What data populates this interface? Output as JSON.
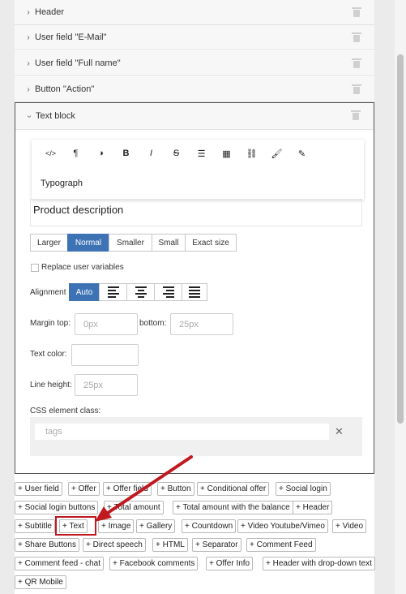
{
  "accordion": {
    "collapsed_items": [
      {
        "label": "Header"
      },
      {
        "label": "User field \"E-Mail\""
      },
      {
        "label": "User field \"Full name\""
      },
      {
        "label": "Button \"Action\""
      }
    ],
    "open_item": {
      "label": "Text block"
    }
  },
  "toolbar": {
    "icons": [
      "code-icon",
      "paragraph-icon",
      "contrast-icon",
      "bold-icon",
      "italic-icon",
      "strikethrough-icon",
      "list-icon",
      "table-icon",
      "link-icon",
      "brush-icon",
      "pencil-icon"
    ],
    "code_glyph": "</>",
    "paragraph_glyph": "¶",
    "contrast_glyph": "◑",
    "bold_glyph": "B",
    "italic_glyph": "I",
    "strike_glyph": "S",
    "list_glyph": "☰",
    "table_glyph": "▦",
    "link_glyph": "⛓",
    "brush_glyph": "🖌",
    "pencil_glyph": "✎",
    "typograph_label": "Typograph"
  },
  "editor": {
    "content": "Product description"
  },
  "size": {
    "options": [
      "Larger",
      "Normal",
      "Smaller",
      "Small",
      "Exact size"
    ],
    "selected": "Normal"
  },
  "replace_vars": {
    "label": "Replace user variables",
    "checked": false
  },
  "alignment": {
    "label": "Alignment",
    "auto_label": "Auto",
    "selected": "Auto"
  },
  "margin": {
    "top_label": "Margin top:",
    "top_placeholder": "0px",
    "bottom_label": "bottom:",
    "bottom_placeholder": "25px"
  },
  "text_color": {
    "label": "Text color:"
  },
  "line_height": {
    "label": "Line height:",
    "placeholder": "25px"
  },
  "css_class": {
    "label": "CSS element class:",
    "placeholder": "tags",
    "clear": "✕"
  },
  "add_buttons": [
    [
      "+ User field",
      "+ Offer",
      "+ Offer field",
      "+ Button",
      "+ Conditional offer",
      "+ Social login"
    ],
    [
      "+ Social login buttons",
      "+ Total amount",
      "+ Total amount with the balance",
      "+ Header"
    ],
    [
      "+ Subtitle",
      "+ Text",
      "+ Image",
      "+ Gallery",
      "+ Countdown",
      "+ Video Youtube/Vimeo",
      "+ Video"
    ],
    [
      "+ Share Buttons",
      "+ Direct speech",
      "+ HTML",
      "+ Separator",
      "+ Comment Feed"
    ],
    [
      "+ Comment feed - chat",
      "+ Facebook comments",
      "+ Offer Info",
      "+ Header with drop-down text"
    ],
    [
      "+ QR Mobile"
    ]
  ],
  "annotation": {
    "highlighted_button": "+ Text",
    "color": "#c0191f"
  },
  "colors": {
    "accent": "#3d73b5",
    "highlight": "#c0191f"
  }
}
